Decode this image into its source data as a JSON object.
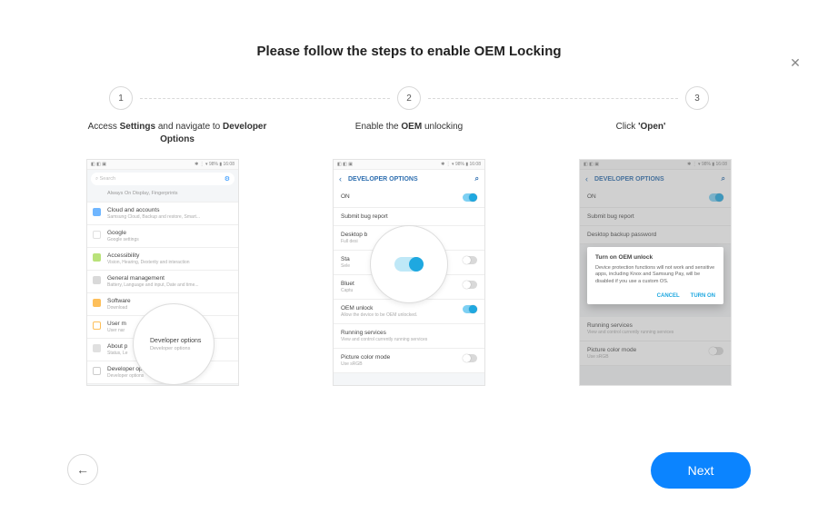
{
  "close_label": "✕",
  "title": "Please follow the steps to enable OEM Locking",
  "steps": {
    "n1": "1",
    "n2": "2",
    "n3": "3"
  },
  "captions": {
    "c1_a": "Access ",
    "c1_b": "Settings",
    "c1_c": " and navigate to ",
    "c1_d": "Developer Options",
    "c2_a": "Enable the ",
    "c2_b": "OEM",
    "c2_c": " unlocking",
    "c3_a": "Click ",
    "c3_b": "'Open'"
  },
  "phone1": {
    "status_left": "◧ ◧ ▣",
    "status_right": "✱ ⋮ ▾ 98% ▮ 16:08",
    "search_placeholder": "Search",
    "search_icon": "⌕",
    "always": "Always On Display, Fingerprints",
    "items": [
      {
        "t": "Cloud and accounts",
        "s": "Samsung Cloud, Backup and restore, Smart..."
      },
      {
        "t": "Google",
        "s": "Google settings"
      },
      {
        "t": "Accessibility",
        "s": "Vision, Hearing, Dexterity and interaction"
      },
      {
        "t": "General management",
        "s": "Battery, Language and input, Date and time..."
      },
      {
        "t": "Software",
        "s": "Download"
      },
      {
        "t": "User m",
        "s": "User nar"
      },
      {
        "t": "About p",
        "s": "Status, Le"
      },
      {
        "t": "Developer options",
        "s": "Developer options"
      }
    ],
    "mag_title": "Developer options",
    "mag_sub": "Developer options"
  },
  "phone23_status_left": "◧ ◧ ▣",
  "phone23_status_right": "✱ ⋮ ▾ 98% ▮ 16:08",
  "dev_header": "DEVELOPER OPTIONS",
  "phone2": {
    "rows": [
      {
        "t": "ON",
        "on": true
      },
      {
        "t": "Submit bug report"
      },
      {
        "t": "Desktop b",
        "s": "Full desi"
      },
      {
        "t": "Sta",
        "s": "Sele",
        "off": true
      },
      {
        "t": "Bluet",
        "s": "Captu",
        "off": true
      },
      {
        "t": "OEM unlock",
        "s": "Allow the device to be OEM unlocked.",
        "on": true
      },
      {
        "t": "Running services",
        "s": "View and control currently running services"
      },
      {
        "t": "Picture color mode",
        "s": "Use sRGB",
        "off": true
      }
    ]
  },
  "phone3": {
    "rows": [
      {
        "t": "ON",
        "on": true
      },
      {
        "t": "Submit bug report"
      },
      {
        "t": "Desktop backup password"
      }
    ],
    "rows_below": [
      {
        "t": "Running services",
        "s": "View and control currently running services"
      },
      {
        "t": "Picture color mode",
        "s": "Use sRGB",
        "off": true
      }
    ],
    "dialog": {
      "title": "Turn on OEM unlock",
      "body": "Device protection functions will not work and sensitive apps, including Knox and Samsung Pay, will be disabled if you use a custom OS.",
      "cancel": "CANCEL",
      "turnon": "TURN ON"
    }
  },
  "back_icon": "←",
  "next_label": "Next"
}
